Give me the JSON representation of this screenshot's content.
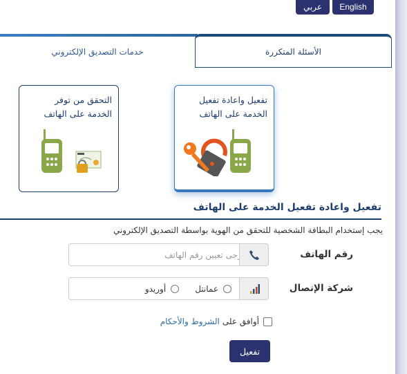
{
  "language_switch": {
    "english": "English",
    "arabic": "عربي"
  },
  "tabs": [
    {
      "label": "الأسئلة المتكررة",
      "active": false
    },
    {
      "label": "خدمات التصديق الإلكتروني",
      "active": true
    }
  ],
  "cards": [
    {
      "title_line1": "تفعيل واعادة تفعيل",
      "title_line2": "الخدمة على الهاتف",
      "selected": true,
      "icons": [
        "key-lock-icon",
        "mobile-phone-icon"
      ]
    },
    {
      "title_line1": "التحقق من توفر",
      "title_line2": "الخدمة على الهاتف",
      "selected": false,
      "icons": [
        "mobile-phone-icon",
        "certificate-lock-icon"
      ]
    }
  ],
  "section": {
    "title": "تفعيل واعادة تفعيل الخدمة على الهاتف",
    "notice": "يجب إستخدام البطاقة الشخصية للتحقق من الهوية بواسطة التصديق الإلكتروني"
  },
  "form": {
    "phone_label": "رقم الهاتف",
    "phone_placeholder": "يرجى تعيين رقم الهاتف",
    "phone_value": "",
    "carrier_label": "شركة الإتصال",
    "carrier_options": [
      "عمانتل",
      "أوريدو"
    ],
    "carrier_selected": null,
    "terms_prefix": "أوافق على",
    "terms_link": "الشروط والأحكام",
    "terms_checked": false,
    "submit_label": "تفعيل"
  },
  "colors": {
    "primary": "#2c3170",
    "accent": "#3a78bd",
    "title": "#1e3f6e",
    "link": "#2e6da4",
    "phone_green": "#8aa84a"
  }
}
